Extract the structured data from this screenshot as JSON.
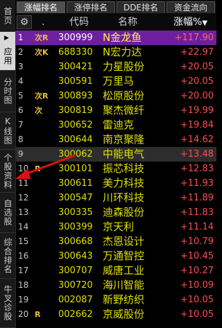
{
  "sidebar": {
    "items": [
      {
        "label": "首页",
        "active": false
      },
      {
        "label": "应用",
        "active": true
      },
      {
        "label": "分时图",
        "active": false
      },
      {
        "label": "K线图",
        "active": false
      },
      {
        "label": "个股资料",
        "active": false
      },
      {
        "label": "自选股",
        "active": false
      },
      {
        "label": "综合排名",
        "active": false
      },
      {
        "label": "牛叉诊股",
        "active": false
      }
    ]
  },
  "tabs": [
    {
      "label": "涨幅排名",
      "active": true
    },
    {
      "label": "涨停排名",
      "active": false
    },
    {
      "label": "DDE排名",
      "active": false
    },
    {
      "label": "资金流向",
      "active": false
    }
  ],
  "header": {
    "settings_icon": "gear-icon",
    "dot": ".",
    "code": "代码",
    "name": "名称",
    "change": "涨幅%",
    "sort_icon": "triangle-down-icon"
  },
  "rows": [
    {
      "idx": "1",
      "flag": "次R",
      "code": "300999",
      "name": "N金龙鱼",
      "pct": "+117.90"
    },
    {
      "idx": "2",
      "flag": "次K",
      "code": "688330",
      "name": "N宏力达",
      "pct": "+22.97"
    },
    {
      "idx": "3",
      "flag": "",
      "code": "300421",
      "name": "力星股份",
      "pct": "+20.05"
    },
    {
      "idx": "4",
      "flag": "",
      "code": "300591",
      "name": "万里马",
      "pct": "+20.05"
    },
    {
      "idx": "5",
      "flag": "次R",
      "code": "300893",
      "name": "松原股份",
      "pct": "+20.00"
    },
    {
      "idx": "6",
      "flag": "次",
      "code": "300819",
      "name": "聚杰微纤",
      "pct": "+19.99"
    },
    {
      "idx": "7",
      "flag": "",
      "code": "300652",
      "name": "雷迪克",
      "pct": "+19.84"
    },
    {
      "idx": "8",
      "flag": "",
      "code": "300644",
      "name": "南京聚隆",
      "pct": "+14.62"
    },
    {
      "idx": "9",
      "flag": "",
      "code": "300062",
      "name": "中能电气",
      "pct": "+13.48"
    },
    {
      "idx": "10",
      "flag": "R",
      "code": "300101",
      "name": "振芯科技",
      "pct": "+12.83"
    },
    {
      "idx": "11",
      "flag": "",
      "code": "300611",
      "name": "美力科技",
      "pct": "+11.93"
    },
    {
      "idx": "12",
      "flag": "",
      "code": "300547",
      "name": "川环科技",
      "pct": "+11.89"
    },
    {
      "idx": "13",
      "flag": "",
      "code": "300335",
      "name": "迪森股份",
      "pct": "+11.83"
    },
    {
      "idx": "14",
      "flag": "",
      "code": "300399",
      "name": "京天利",
      "pct": "+11.14"
    },
    {
      "idx": "15",
      "flag": "",
      "code": "300668",
      "name": "杰恩设计",
      "pct": "+10.79"
    },
    {
      "idx": "16",
      "flag": "",
      "code": "300643",
      "name": "万通智控",
      "pct": "+10.45"
    },
    {
      "idx": "17",
      "flag": "",
      "code": "300707",
      "name": "威唐工业",
      "pct": "+10.27"
    },
    {
      "idx": "18",
      "flag": "",
      "code": "300720",
      "name": "海川智能",
      "pct": "+10.09"
    },
    {
      "idx": "19",
      "flag": "",
      "code": "002087",
      "name": "新野纺织",
      "pct": "+10.05"
    },
    {
      "idx": "20",
      "flag": "R",
      "code": "002662",
      "name": "京威股份",
      "pct": "+10.05"
    }
  ],
  "colors": {
    "selected_row": "#6e1f9e",
    "up": "#ff4d4d",
    "stock": "#e0e000",
    "flag": "#e9c23a",
    "annotation": "#e01010"
  }
}
